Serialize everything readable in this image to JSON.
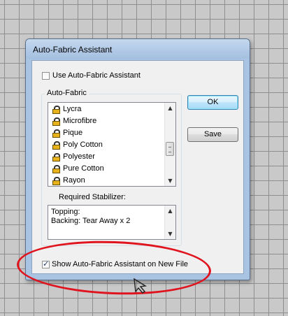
{
  "dialog": {
    "title": "Auto-Fabric Assistant",
    "use_checkbox": {
      "label": "Use Auto-Fabric Assistant",
      "checked": false
    },
    "fabric_group": {
      "label": "Auto-Fabric",
      "items": [
        {
          "label": "Lycra",
          "icon": "lock-icon"
        },
        {
          "label": "Microfibre",
          "icon": "lock-icon"
        },
        {
          "label": "Pique",
          "icon": "lock-icon"
        },
        {
          "label": "Poly Cotton",
          "icon": "lock-icon"
        },
        {
          "label": "Polyester",
          "icon": "lock-icon"
        },
        {
          "label": "Pure Cotton",
          "icon": "lock-icon"
        },
        {
          "label": "Rayon",
          "icon": "lock-icon"
        }
      ],
      "stabilizer_label": "Required Stabilizer:",
      "stabilizer_text": "Topping:\nBacking: Tear Away x 2"
    },
    "ok_label": "OK",
    "save_label": "Save",
    "show_checkbox": {
      "label": "Show Auto-Fabric Assistant on New File",
      "checked": true
    }
  },
  "colors": {
    "highlight_ellipse": "#e0141e",
    "dialog_frame": "#a9c3e2"
  }
}
